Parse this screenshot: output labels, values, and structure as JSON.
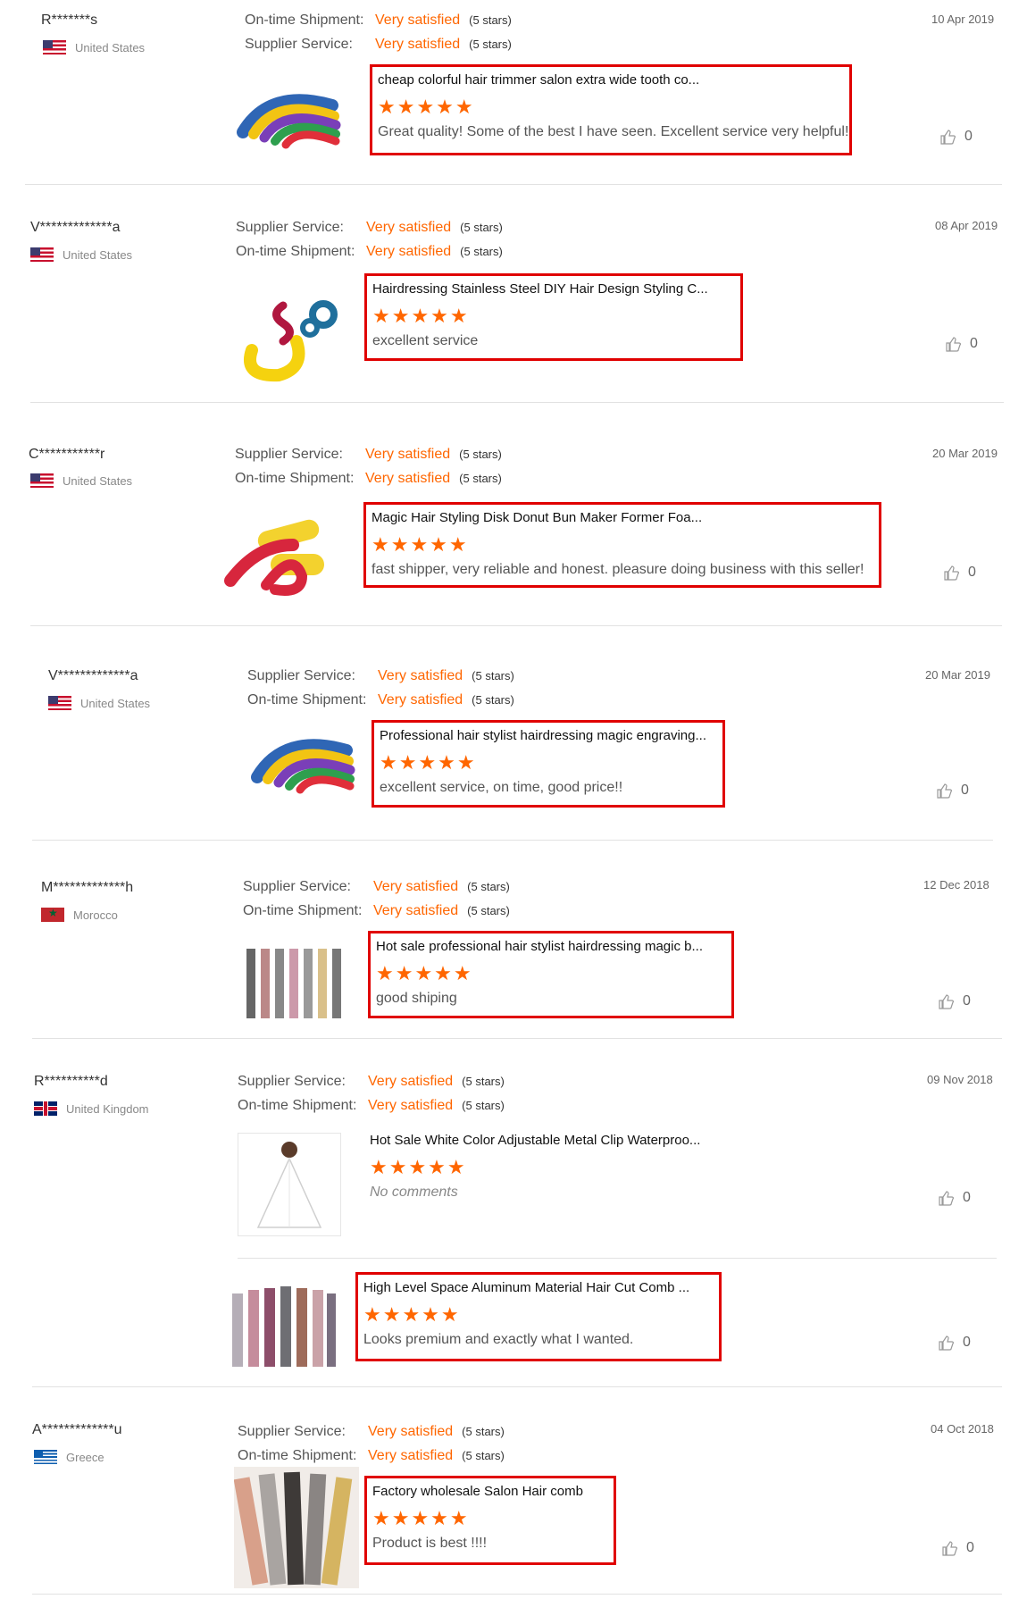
{
  "reviews": [
    {
      "name": "R*******s",
      "country": "United States",
      "flag": "us",
      "date": "10 Apr 2019",
      "ratings": [
        {
          "label": "On-time Shipment:",
          "value": "Very satisfied",
          "stars": "(5 stars)"
        },
        {
          "label": "Supplier Service:",
          "value": "Very satisfied",
          "stars": "(5 stars)"
        }
      ],
      "products": [
        {
          "title": "cheap colorful hair trimmer salon extra wide tooth co...",
          "stars": "★★★★★",
          "comment": "Great quality! Some of the best I have seen. Excellent service very helpful!",
          "likes": "0",
          "image": "foam-rollers-icon"
        }
      ]
    },
    {
      "name": "V*************a",
      "country": "United States",
      "flag": "us",
      "date": "08 Apr 2019",
      "ratings": [
        {
          "label": "Supplier Service:",
          "value": "Very satisfied",
          "stars": "(5 stars)"
        },
        {
          "label": "On-time Shipment:",
          "value": "Very satisfied",
          "stars": "(5 stars)"
        }
      ],
      "products": [
        {
          "title": "Hairdressing Stainless Steel DIY Hair Design Styling C...",
          "stars": "★★★★★",
          "comment": "excellent service",
          "likes": "0",
          "image": "curlers-icon"
        }
      ]
    },
    {
      "name": "C***********r",
      "country": "United States",
      "flag": "us",
      "date": "20 Mar 2019",
      "ratings": [
        {
          "label": "Supplier Service:",
          "value": "Very satisfied",
          "stars": "(5 stars)"
        },
        {
          "label": "On-time Shipment:",
          "value": "Very satisfied",
          "stars": "(5 stars)"
        }
      ],
      "products": [
        {
          "title": "Magic Hair Styling Disk Donut Bun Maker Former Foa...",
          "stars": "★★★★★",
          "comment": "fast shipper, very reliable and honest. pleasure doing business with this seller!",
          "likes": "0",
          "image": "rollers-icon"
        }
      ]
    },
    {
      "name": "V*************a",
      "country": "United States",
      "flag": "us",
      "date": "20 Mar 2019",
      "ratings": [
        {
          "label": "Supplier Service:",
          "value": "Very satisfied",
          "stars": "(5 stars)"
        },
        {
          "label": "On-time Shipment:",
          "value": "Very satisfied",
          "stars": "(5 stars)"
        }
      ],
      "products": [
        {
          "title": "Professional hair stylist hairdressing magic engraving...",
          "stars": "★★★★★",
          "comment": "excellent service, on time, good price!!",
          "likes": "0",
          "image": "foam-rollers-icon"
        }
      ]
    },
    {
      "name": "M*************h",
      "country": "Morocco",
      "flag": "ma",
      "date": "12 Dec 2018",
      "ratings": [
        {
          "label": "Supplier Service:",
          "value": "Very satisfied",
          "stars": "(5 stars)"
        },
        {
          "label": "On-time Shipment:",
          "value": "Very satisfied",
          "stars": "(5 stars)"
        }
      ],
      "products": [
        {
          "title": "Hot sale professional hair stylist hairdressing magic b...",
          "stars": "★★★★★",
          "comment": "good shiping",
          "likes": "0",
          "image": "combs-icon"
        }
      ]
    },
    {
      "name": "R**********d",
      "country": "United Kingdom",
      "flag": "uk",
      "date": "09 Nov 2018",
      "ratings": [
        {
          "label": "Supplier Service:",
          "value": "Very satisfied",
          "stars": "(5 stars)"
        },
        {
          "label": "On-time Shipment:",
          "value": "Very satisfied",
          "stars": "(5 stars)"
        }
      ],
      "products": [
        {
          "title": "Hot Sale White Color Adjustable Metal Clip Waterproo...",
          "stars": "★★★★★",
          "comment": "No comments",
          "likes": "0",
          "image": "cape-icon"
        },
        {
          "title": "High Level Space Aluminum Material Hair Cut Comb ...",
          "stars": "★★★★★",
          "comment": "Looks premium and exactly what I wanted.",
          "likes": "0",
          "image": "combs-icon"
        }
      ]
    },
    {
      "name": "A*************u",
      "country": "Greece",
      "flag": "gr",
      "date": "04 Oct 2018",
      "ratings": [
        {
          "label": "Supplier Service:",
          "value": "Very satisfied",
          "stars": "(5 stars)"
        },
        {
          "label": "On-time Shipment:",
          "value": "Very satisfied",
          "stars": "(5 stars)"
        }
      ],
      "products": [
        {
          "title": "Factory wholesale Salon Hair comb",
          "stars": "★★★★★",
          "comment": "Product is best !!!!",
          "likes": "0",
          "image": "combs-icon"
        }
      ]
    }
  ],
  "colors": {
    "accent": "#ff6600",
    "highlight_border": "#e00000"
  }
}
